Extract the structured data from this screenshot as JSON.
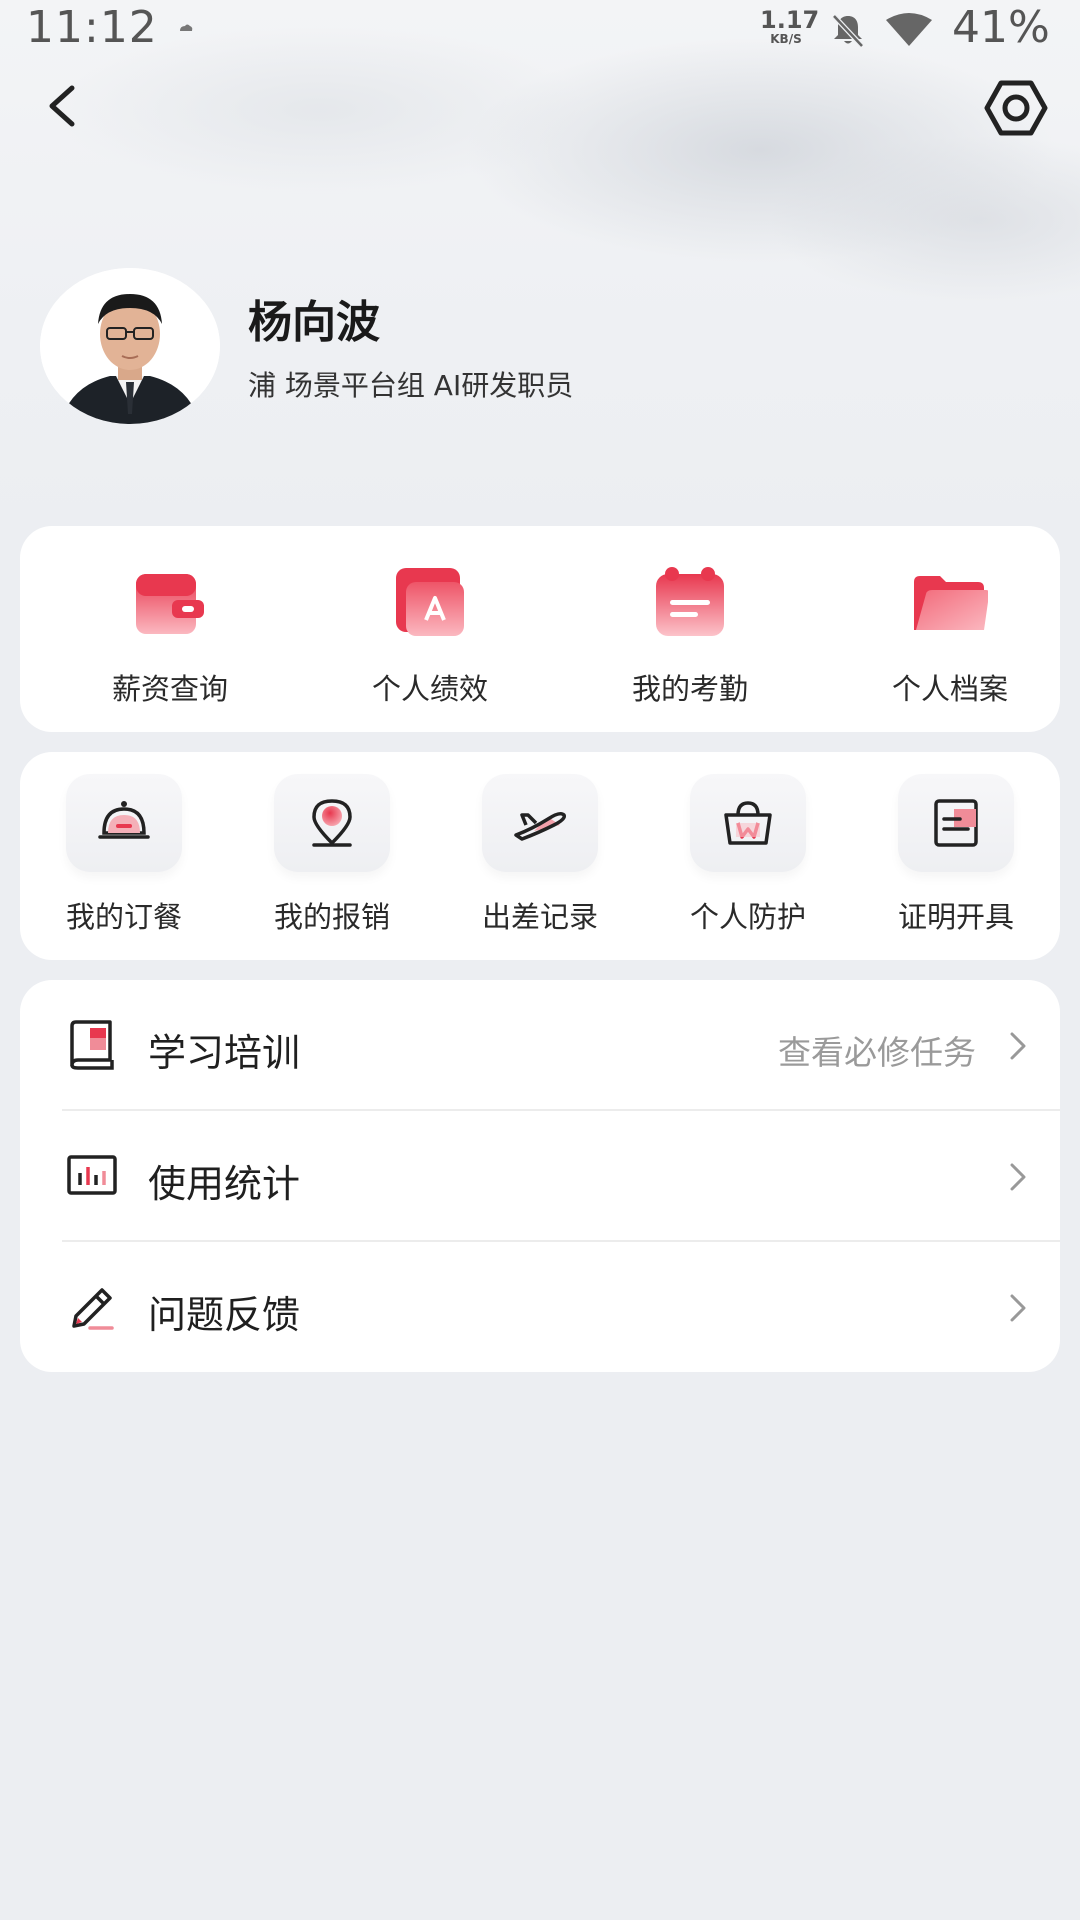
{
  "status_bar": {
    "time": "11:12",
    "net_speed_value": "1.17",
    "net_speed_unit": "KB/S",
    "battery": "41%"
  },
  "profile": {
    "name": "杨向波",
    "department": "浦 场景平台组  AI研发职员"
  },
  "quick_actions": [
    {
      "label": "薪资查询",
      "icon": "wallet-icon"
    },
    {
      "label": "个人绩效",
      "icon": "performance-icon"
    },
    {
      "label": "我的考勤",
      "icon": "calendar-icon"
    },
    {
      "label": "个人档案",
      "icon": "folder-icon"
    }
  ],
  "services": [
    {
      "label": "我的订餐",
      "icon": "meal-cloche-icon"
    },
    {
      "label": "我的报销",
      "icon": "location-pin-icon"
    },
    {
      "label": "出差记录",
      "icon": "airplane-icon"
    },
    {
      "label": "个人防护",
      "icon": "basket-icon"
    },
    {
      "label": "证明开具",
      "icon": "document-icon"
    }
  ],
  "menu": [
    {
      "label": "学习培训",
      "hint": "查看必修任务",
      "icon": "book-icon"
    },
    {
      "label": "使用统计",
      "hint": "",
      "icon": "bar-chart-icon"
    },
    {
      "label": "问题反馈",
      "hint": "",
      "icon": "pen-icon"
    }
  ],
  "colors": {
    "accent": "#e8384f",
    "accent_light": "#f9a4ae",
    "background": "#eceef2",
    "card": "#ffffff"
  }
}
